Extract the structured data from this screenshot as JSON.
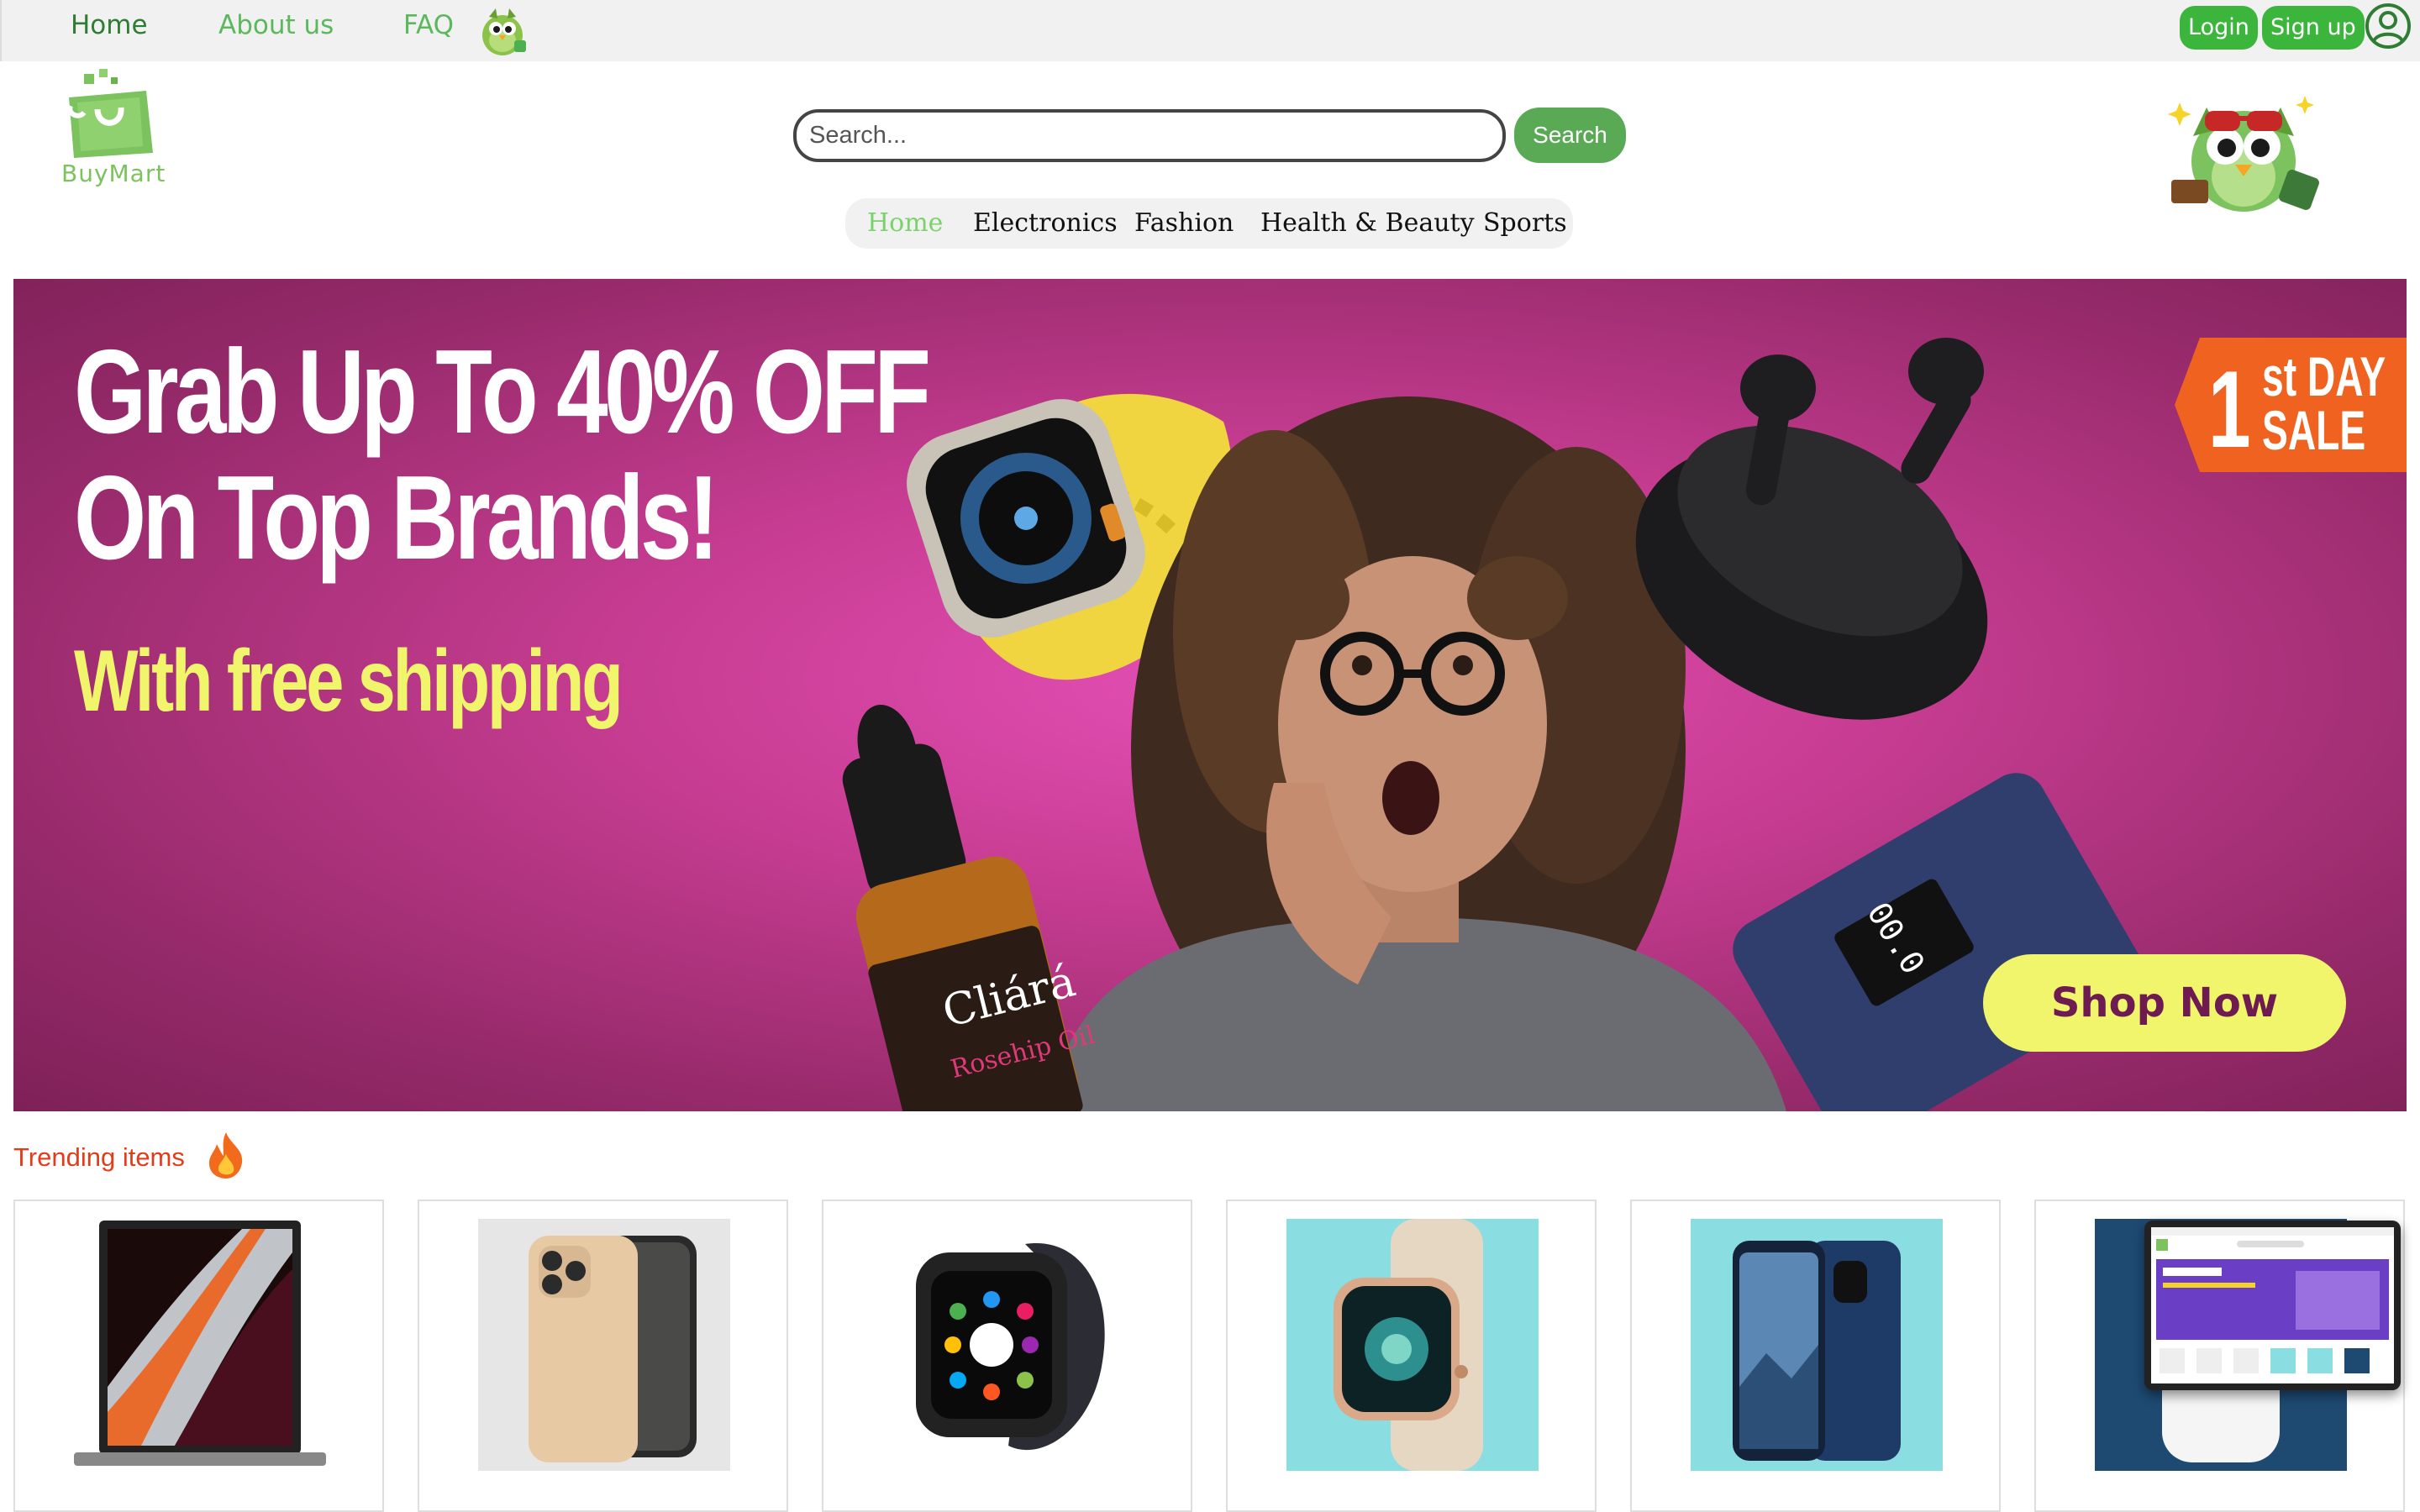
{
  "topbar": {
    "nav": [
      "Home",
      "About us",
      "FAQ"
    ],
    "login_label": "Login",
    "signup_label": "Sign up"
  },
  "brand": {
    "name": "BuyMart"
  },
  "search": {
    "placeholder": "Search...",
    "button_label": "Search"
  },
  "categories": [
    "Home",
    "Electronics",
    "Fashion",
    "Health & Beauty",
    "Sports"
  ],
  "hero": {
    "headline_line1": "Grab Up To 40% OFF",
    "headline_line2": "On Top Brands!",
    "subline": "With free shipping",
    "badge_number": "1",
    "badge_text": "st DAY\nSALE",
    "product_label": "Cliárá",
    "product_sublabel": "Rosehip Oil",
    "cta_label": "Shop Now"
  },
  "trending": {
    "title": "Trending items"
  },
  "colors": {
    "brand_green": "#3cb53c",
    "link_green": "#5cb85c",
    "hero_magenta": "#c83d93",
    "hero_yellow": "#f1f56b",
    "trending_red": "#e23d1b"
  },
  "icons": [
    "mascot-icon",
    "user-icon",
    "shopping-bag-logo-icon",
    "fire-icon"
  ]
}
